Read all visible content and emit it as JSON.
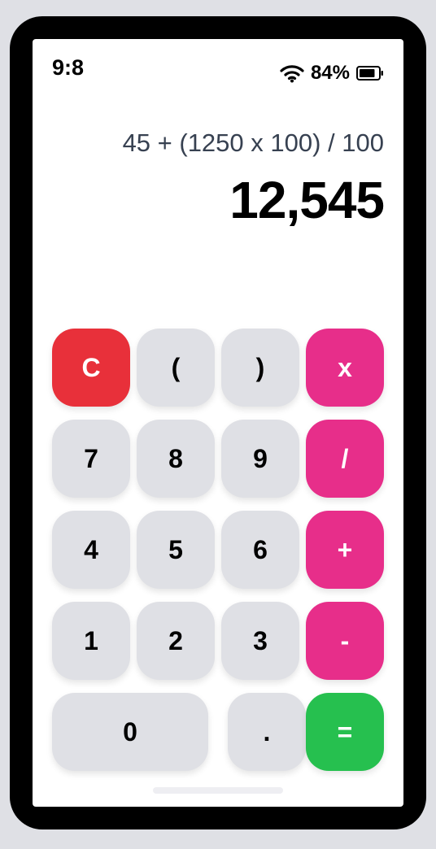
{
  "status_bar": {
    "time": "9:8",
    "battery_percent": "84%",
    "wifi_icon": "wifi-icon",
    "battery_icon": "battery-icon",
    "battery_level": 0.84
  },
  "display": {
    "expression": "45 + (1250 x 100) / 100",
    "result": "12,545"
  },
  "keys": {
    "clear": "C",
    "open_paren": "(",
    "close_paren": ")",
    "multiply": "x",
    "seven": "7",
    "eight": "8",
    "nine": "9",
    "divide": "/",
    "four": "4",
    "five": "5",
    "six": "6",
    "plus": "+",
    "one": "1",
    "two": "2",
    "three": "3",
    "minus": "-",
    "zero": "0",
    "decimal": ".",
    "equals": "="
  },
  "colors": {
    "clear_key": "#e8303a",
    "operator_key": "#e72e8a",
    "equals_key": "#26c04f",
    "neutral_key": "#dfe0e5"
  }
}
